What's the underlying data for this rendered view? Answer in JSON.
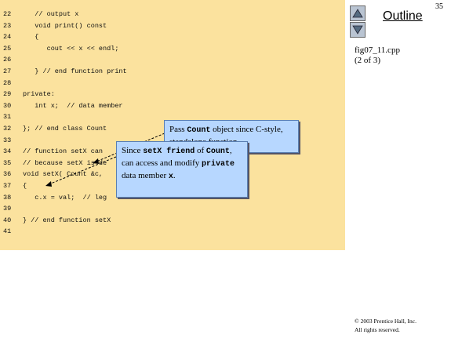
{
  "slide": {
    "number": "35",
    "outline_title": "Outline",
    "file_name": "fig07_11.cpp",
    "file_part": "(2 of 3)",
    "copyright_line1": "© 2003 Prentice Hall, Inc.",
    "copyright_line2": "All rights reserved."
  },
  "nav": {
    "up_icon": "up-arrow-icon",
    "down_icon": "down-arrow-icon"
  },
  "code": {
    "lines": [
      {
        "num": "22",
        "text": "   // output x"
      },
      {
        "num": "23",
        "text": "   void print() const"
      },
      {
        "num": "24",
        "text": "   {"
      },
      {
        "num": "25",
        "text": "      cout << x << endl;"
      },
      {
        "num": "26",
        "text": ""
      },
      {
        "num": "27",
        "text": "   } // end function print"
      },
      {
        "num": "28",
        "text": ""
      },
      {
        "num": "29",
        "text": "private:"
      },
      {
        "num": "30",
        "text": "   int x;  // data member"
      },
      {
        "num": "31",
        "text": ""
      },
      {
        "num": "32",
        "text": "}; // end class Count"
      },
      {
        "num": "33",
        "text": ""
      },
      {
        "num": "34",
        "text": "// function setX can"
      },
      {
        "num": "35",
        "text": "// because setX is de"
      },
      {
        "num": "36",
        "text": "void setX( Count &c,"
      },
      {
        "num": "37",
        "text": "{"
      },
      {
        "num": "38",
        "text": "   c.x = val;  // leg"
      },
      {
        "num": "39",
        "text": ""
      },
      {
        "num": "40",
        "text": "} // end function setX"
      },
      {
        "num": "41",
        "text": ""
      }
    ]
  },
  "callouts": {
    "pass": {
      "t1": "Pass ",
      "b1": "Count",
      "t2": " object since C-style, standalone function."
    },
    "friend": {
      "t1": "Since ",
      "b1": "setX friend",
      "t2": " of ",
      "b2": "Count",
      "t3": ", can access and modify ",
      "b3": "private",
      "t4": " data member ",
      "b4": "x",
      "t5": "."
    }
  }
}
